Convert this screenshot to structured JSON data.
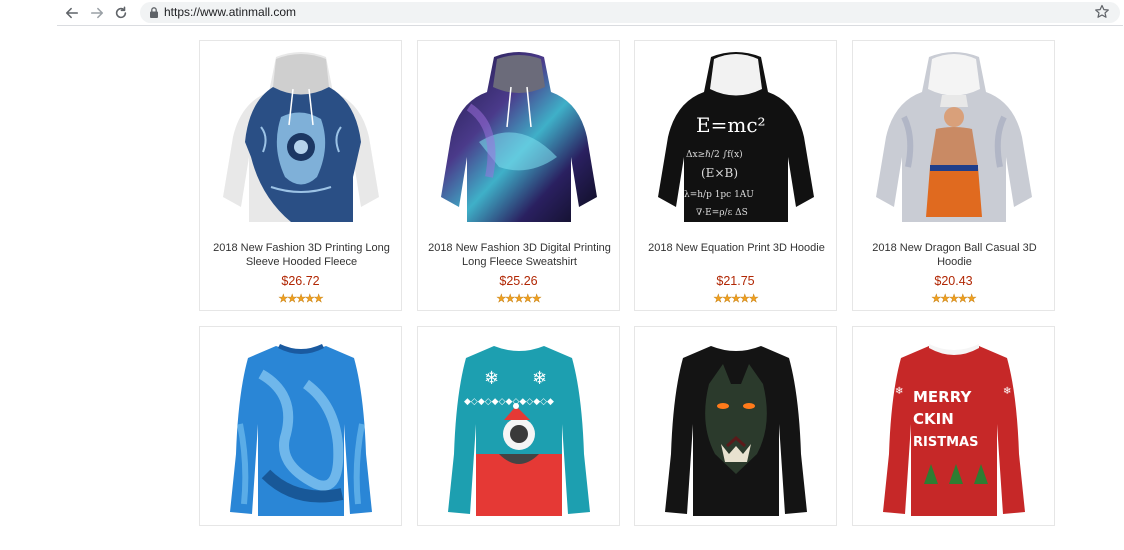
{
  "browser": {
    "url": "https://www.atinmall.com",
    "icons": [
      "back-arrow-icon",
      "forward-arrow-icon",
      "reload-icon",
      "lock-icon",
      "bookmark-star-icon"
    ]
  },
  "products": [
    {
      "title": "2018 New Fashion 3D Printing Long Sleeve Hooded Fleece",
      "price": "$26.72",
      "rating": "★★★★★",
      "image": "blue-paisley-hoodie"
    },
    {
      "title": "2018 New Fashion 3D Digital Printing Long Fleece Sweatshirt",
      "price": "$25.26",
      "rating": "★★★★★",
      "image": "galaxy-hoodie"
    },
    {
      "title": "2018 New Equation Print 3D Hoodie",
      "price": "$21.75",
      "rating": "★★★★★",
      "image": "equation-hoodie"
    },
    {
      "title": "2018 New Dragon Ball Casual 3D Hoodie",
      "price": "$20.43",
      "rating": "★★★★★",
      "image": "dragon-ball-hoodie"
    },
    {
      "title": "",
      "price": "",
      "rating": "",
      "image": "blue-marble-sweatshirt"
    },
    {
      "title": "",
      "price": "",
      "rating": "",
      "image": "teal-christmas-cat-sweatshirt"
    },
    {
      "title": "",
      "price": "",
      "rating": "",
      "image": "wolf-sweatshirt"
    },
    {
      "title": "",
      "price": "",
      "rating": "",
      "image": "merry-christmas-sweater"
    }
  ],
  "colors": {
    "price": "#b12704",
    "star": "#f0a020",
    "card_border": "#e6e6e6"
  }
}
